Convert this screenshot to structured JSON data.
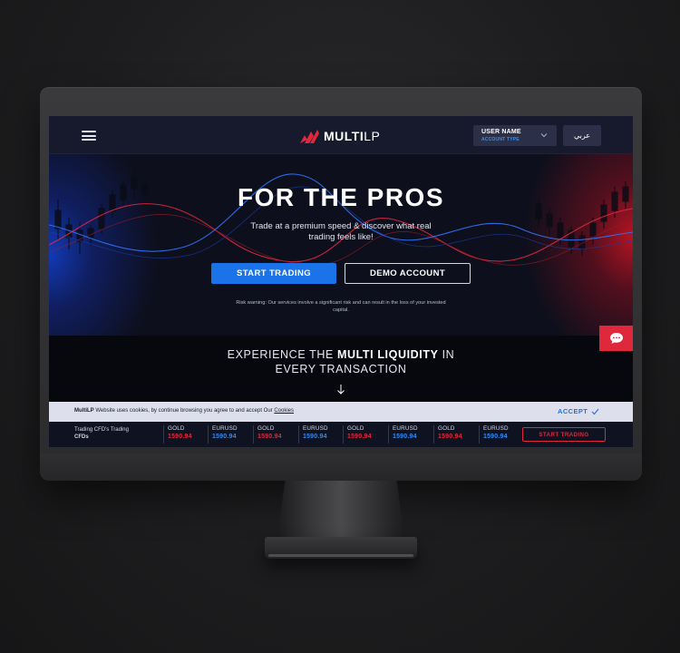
{
  "header": {
    "logo_text_bold": "MULTI",
    "logo_text_light": "LP",
    "user_name": "USER NAME",
    "account_type": "ACCOUNT TYPE",
    "language": "عربي"
  },
  "hero": {
    "title": "FOR THE PROS",
    "subtitle": "Trade at a premium speed & discover what real trading feels like!",
    "start_button": "START TRADING",
    "demo_button": "DEMO ACCOUNT",
    "risk_warning": "Risk warning: Our services involve a significant risk and can result in the loss of your invested capital."
  },
  "experience": {
    "line1_prefix": "EXPERIENCE THE ",
    "line1_bold": "MULTI LIQUIDITY",
    "line1_suffix": " IN",
    "line2": "EVERY TRANSACTION"
  },
  "cookie": {
    "brand": "MultiLP",
    "text": " Website uses cookies, by continue browsing you agree to and accept Our ",
    "link": "Cookies",
    "accept": "ACCEPT"
  },
  "ticker": {
    "label_prefix": "Trading CFD's Trading",
    "label_bold": "CFDs",
    "items": [
      {
        "name": "GOLD",
        "price": "1590.94",
        "color": "#e0283c"
      },
      {
        "name": "EURUSD",
        "price": "1590.94",
        "color": "#2f8cf5"
      },
      {
        "name": "GOLD",
        "price": "1590.94",
        "color": "#e0283c"
      },
      {
        "name": "EURUSD",
        "price": "1590.94",
        "color": "#2f8cf5"
      },
      {
        "name": "GOLD",
        "price": "1590.94",
        "color": "#e0283c"
      },
      {
        "name": "EURUSD",
        "price": "1590.94",
        "color": "#2f8cf5"
      },
      {
        "name": "GOLD",
        "price": "1590.94",
        "color": "#e0283c"
      },
      {
        "name": "EURUSD",
        "price": "1590.94",
        "color": "#2f8cf5"
      }
    ],
    "button": "START TRADING"
  },
  "colors": {
    "accent_blue": "#1a73e8",
    "accent_red": "#e0283c"
  },
  "icons": {
    "menu": "hamburger-icon",
    "dropdown": "chevron-down-icon",
    "scroll": "arrow-down-icon",
    "accept": "check-icon",
    "chat": "chat-bubble-icon"
  }
}
